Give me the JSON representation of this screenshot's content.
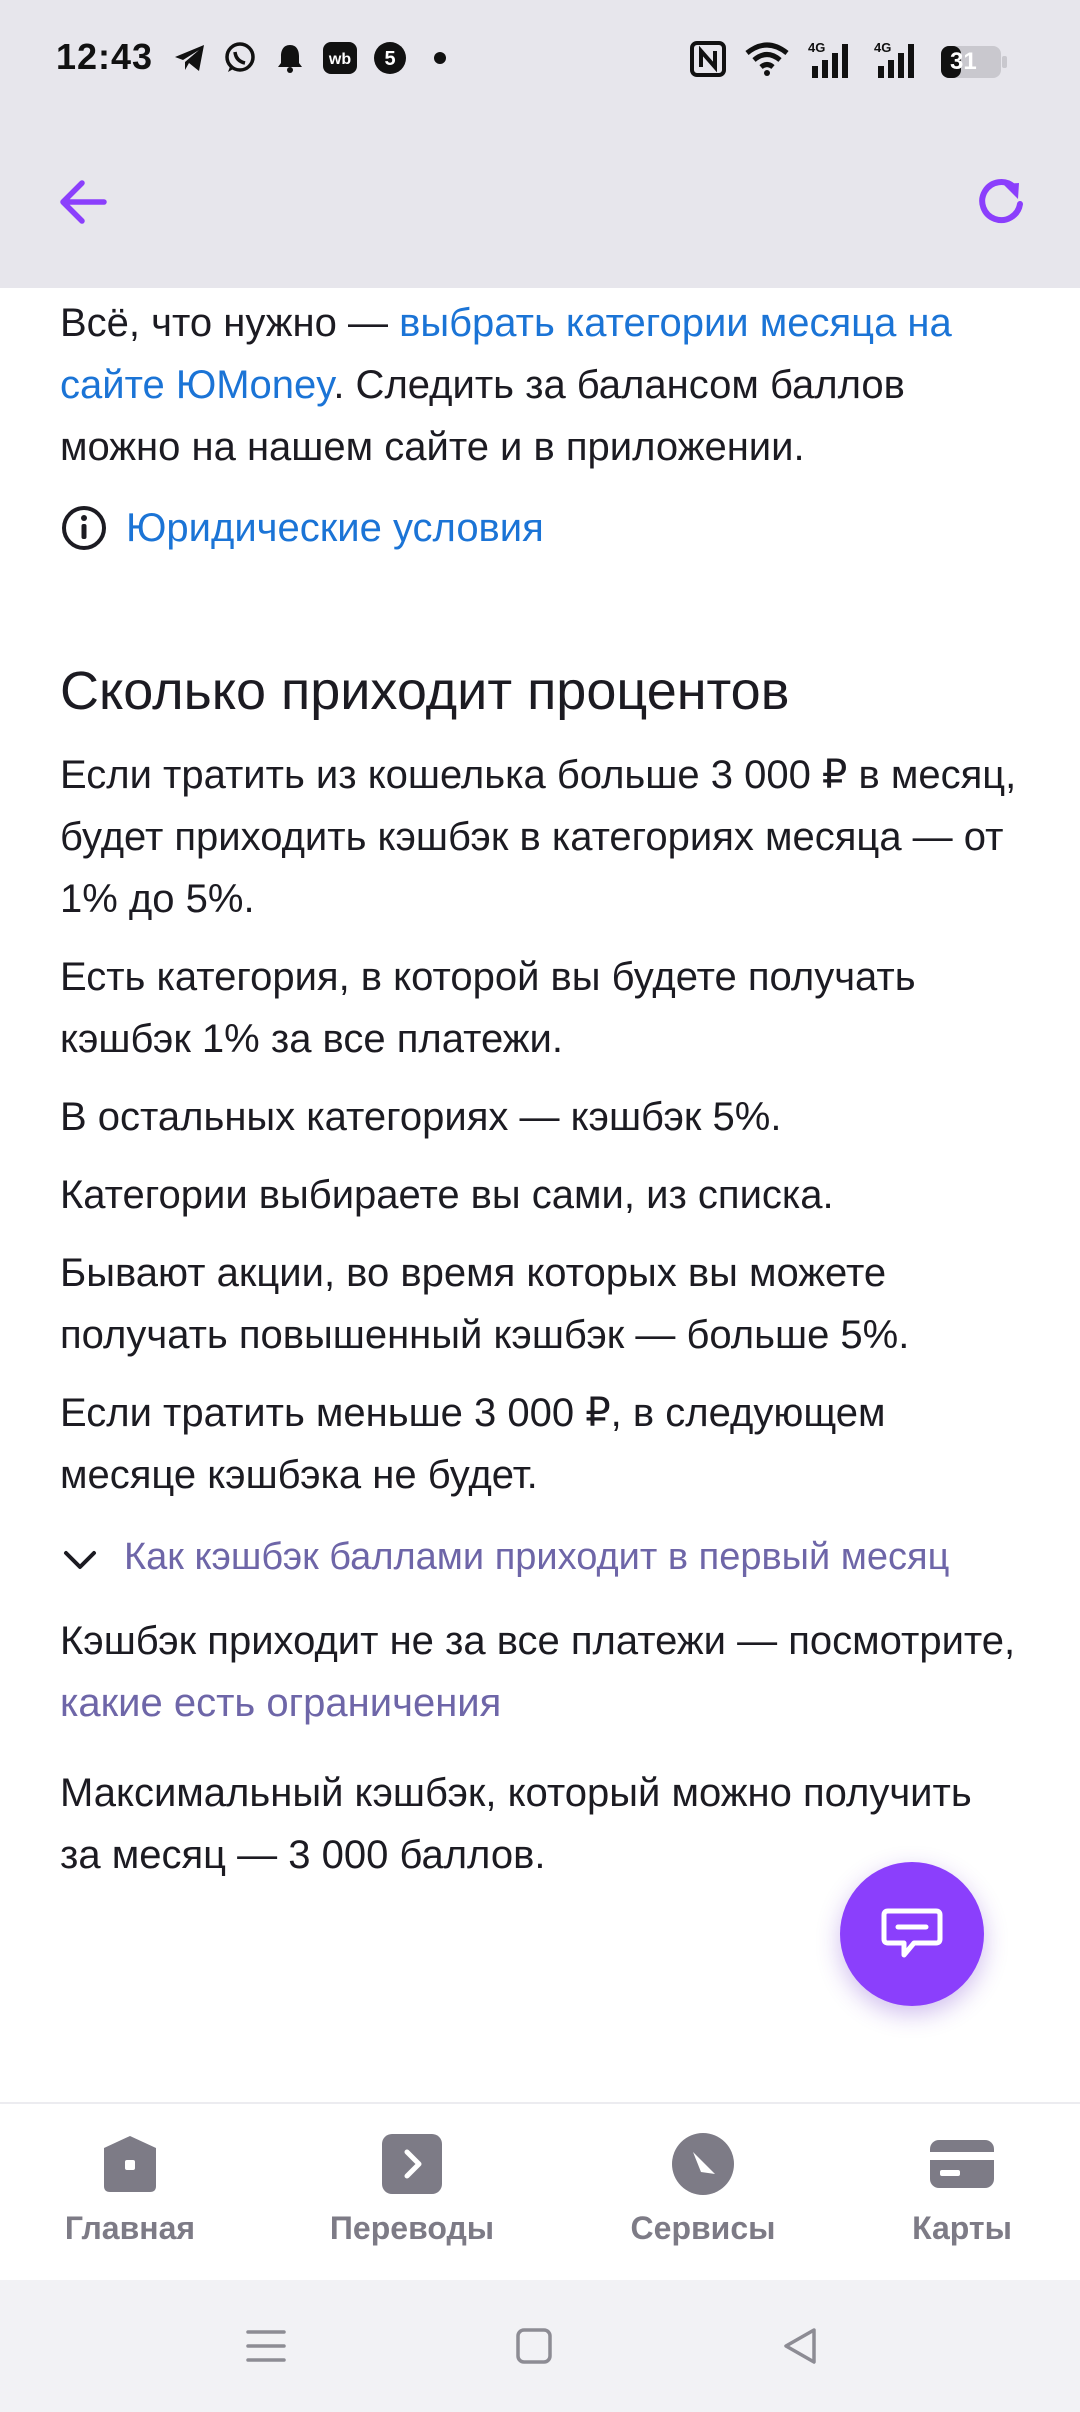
{
  "status_bar": {
    "time": "12:43",
    "left_icons": [
      "telegram-icon",
      "whatsapp-icon",
      "bell-icon",
      "wb-icon",
      "five-icon",
      "dot-icon"
    ],
    "right_icons": [
      "nfc-icon",
      "wifi-icon",
      "signal-4g-icon",
      "signal-4g-icon",
      "battery-icon"
    ],
    "battery": "31"
  },
  "header": {
    "accent_color": "#8b3ffc",
    "back_icon": "arrow-left-icon",
    "refresh_icon": "refresh-icon"
  },
  "content": {
    "intro_prefix": "Всё, что нужно — ",
    "intro_link": "выбрать категории месяца на сайте ЮMoney",
    "intro_suffix": ". Следить за балансом баллов можно на нашем сайте и в приложении.",
    "legal_link": "Юридические условия",
    "section_title": "Сколько приходит процентов",
    "paragraphs": [
      "Если тратить из кошелька больше 3 000 ₽ в месяц, будет приходить кэшбэк в категориях месяца — от 1% до 5%.",
      "Есть категория, в которой вы будете получать кэшбэк 1% за все платежи.",
      "В остальных категориях — кэшбэк 5%.",
      "Категории выбираете вы сами, из списка.",
      "Бывают акции, во время которых вы можете получать повышенный кэшбэк — больше 5%.",
      "Если тратить меньше 3 000 ₽, в следующем месяце кэшбэка не будет."
    ],
    "expander_label": "Как кэшбэк баллами приходит в первый месяц",
    "restrictions_prefix": "Кэшбэк приходит не за все платежи — посмотрите, ",
    "restrictions_link": "какие есть ограничения",
    "max_text": "Максимальный кэшбэк, который можно получить за месяц — 3 000 баллов."
  },
  "chat_fab": {
    "icon": "chat-icon",
    "color": "#8b3ffc"
  },
  "bottom_nav": {
    "items": [
      {
        "label": "Главная",
        "icon": "home-icon"
      },
      {
        "label": "Переводы",
        "icon": "transfer-icon"
      },
      {
        "label": "Сервисы",
        "icon": "services-icon"
      },
      {
        "label": "Карты",
        "icon": "card-icon"
      }
    ]
  },
  "system_nav": {
    "icons": [
      "menu-icon",
      "home-square-icon",
      "back-triangle-icon"
    ]
  }
}
